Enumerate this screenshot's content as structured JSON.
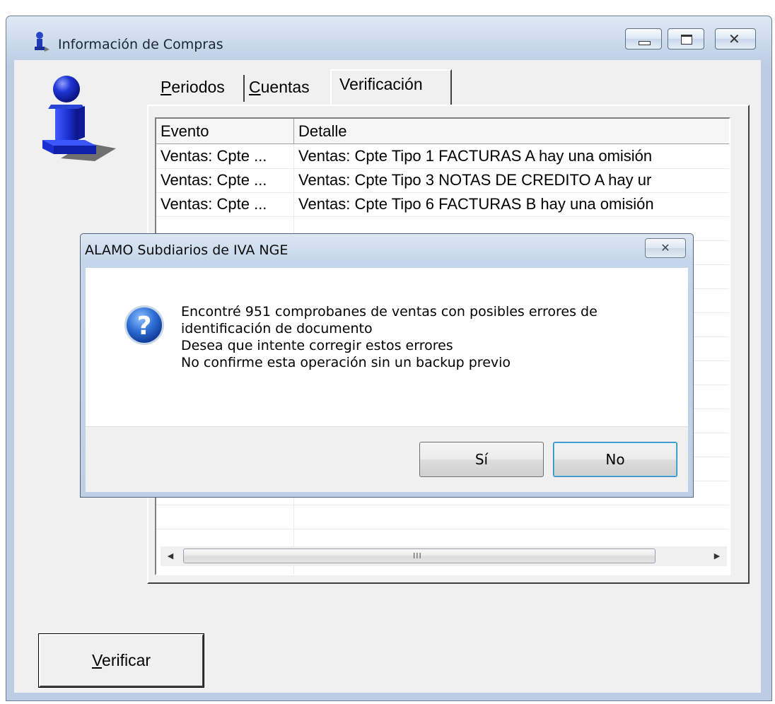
{
  "window": {
    "title": "Información de Compras",
    "icon": "user-pawn-icon"
  },
  "tabs": [
    {
      "label_pre": "",
      "mnemonic": "P",
      "label_post": "eriodos"
    },
    {
      "label_pre": "",
      "mnemonic": "C",
      "label_post": "uentas"
    },
    {
      "label_pre": "Verificación",
      "mnemonic": "",
      "label_post": ""
    }
  ],
  "grid": {
    "columns": [
      "Evento",
      "Detalle"
    ],
    "rows": [
      {
        "evento": "Ventas: Cpte ...",
        "detalle": "Ventas: Cpte Tipo 1 FACTURAS A hay una omisión"
      },
      {
        "evento": "Ventas: Cpte ...",
        "detalle": "Ventas: Cpte Tipo 3 NOTAS DE CREDITO A hay ur"
      },
      {
        "evento": "Ventas: Cpte ...",
        "detalle": "Ventas: Cpte Tipo 6 FACTURAS B hay una omisión"
      }
    ],
    "scroll_grip": "III"
  },
  "verificar_button": {
    "mnemonic": "V",
    "label_post": "erificar"
  },
  "dialog": {
    "title": "ALAMO Subdiarios de IVA NGE",
    "icon": "question-icon",
    "lines": [
      "Encontré 951 comprobanes de ventas con posibles errores de",
      "identificación de documento",
      "Desea que intente corregir estos errores",
      "No confirme esta operación sin un backup previo"
    ],
    "yes_label": "Sí",
    "no_label": "No",
    "close_glyph": "✕"
  }
}
